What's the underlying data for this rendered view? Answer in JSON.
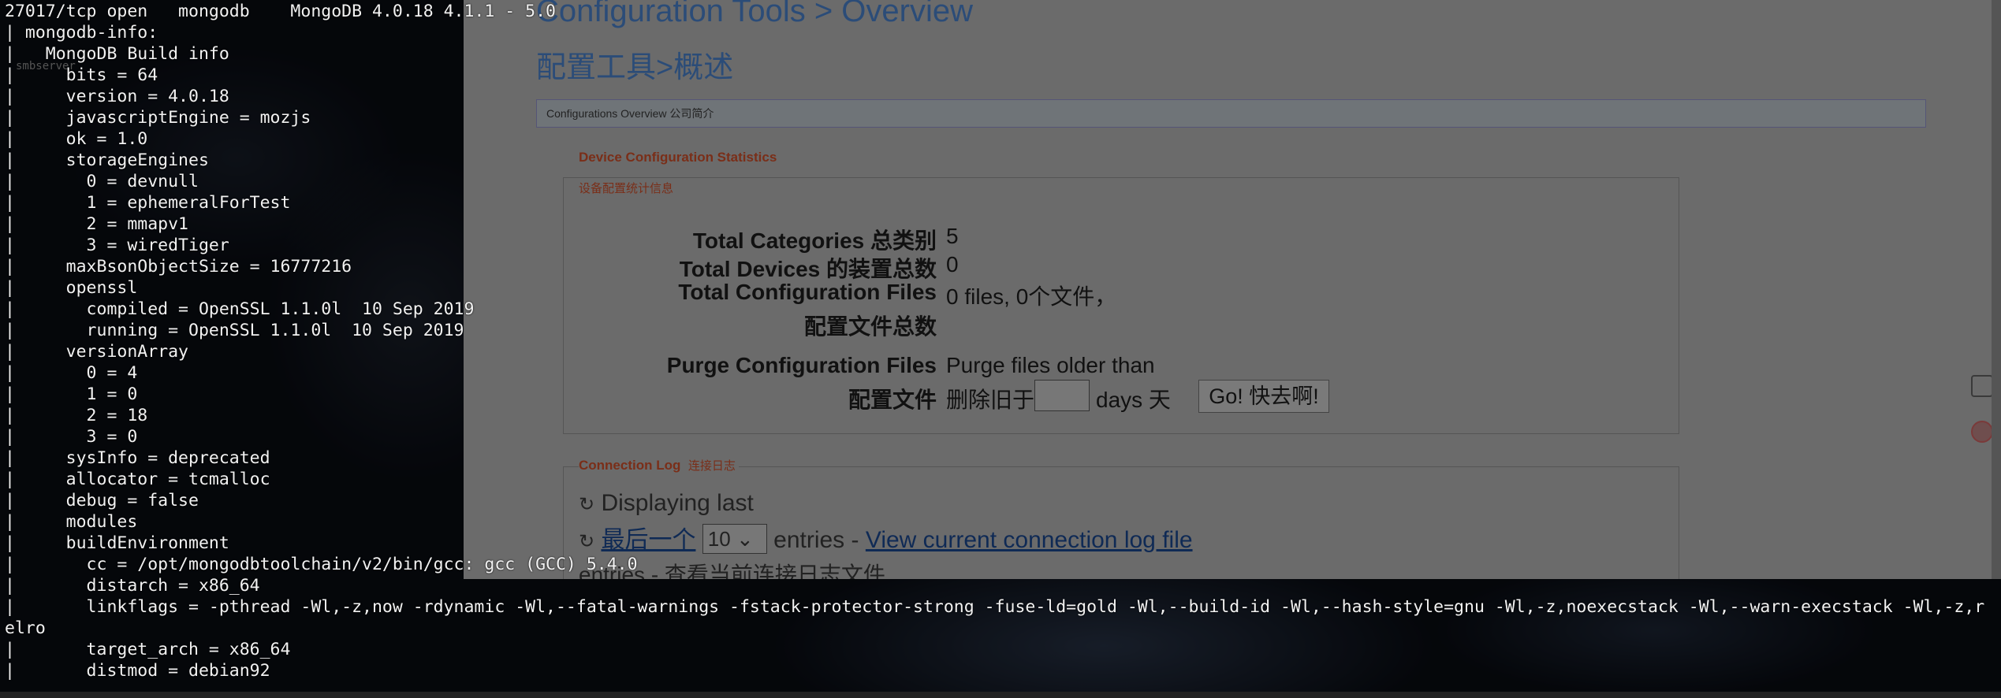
{
  "browser": {
    "title_en": "Configuration Tools > Overview",
    "title_zh": "配置工具>概述",
    "breadcrumb": "Configurations Overview   公司简介",
    "stats_legend_en": "Device Configuration Statistics",
    "stats_legend_zh": "设备配置统计信息",
    "stats": {
      "total_categories_label": "Total Categories  总类别",
      "total_categories_value": "5",
      "total_devices_label": "Total Devices  的装置总数",
      "total_devices_value": "0",
      "total_config_files_label": "Total Configuration Files",
      "total_config_files_label_zh": "配置文件总数",
      "total_config_files_value": "0 files,  0个文件，",
      "purge_label": "Purge Configuration Files",
      "purge_label_zh": "配置文件",
      "purge_text": "Purge files older than",
      "purge_text_zh": "删除旧于",
      "purge_days_value": "",
      "purge_days_label": "days   天",
      "go_button": "Go!  快去啊!"
    },
    "connection_log": {
      "legend_en": "Connection Log",
      "legend_zh": "连接日志",
      "displaying_last": "Displaying last",
      "last_one_zh": "最后一个",
      "entries_select": "10 ⌄",
      "entries_text": "entries -",
      "view_link": "View current connection log file",
      "view_link_zh": "entries - 查看当前连接日志文件"
    },
    "side_icons": [
      "grid-icon",
      "avatar-icon"
    ]
  },
  "terminal": {
    "smbserver_label": "smbserver",
    "lines": [
      "27017/tcp open   mongodb    MongoDB 4.0.18 4.1.1 - 5.0",
      "| mongodb-info:",
      "|   MongoDB Build info",
      "|     bits = 64",
      "|     version = 4.0.18",
      "|     javascriptEngine = mozjs",
      "|     ok = 1.0",
      "|     storageEngines",
      "|       0 = devnull",
      "|       1 = ephemeralForTest",
      "|       2 = mmapv1",
      "|       3 = wiredTiger",
      "|     maxBsonObjectSize = 16777216",
      "|     openssl",
      "|       compiled = OpenSSL 1.1.0l  10 Sep 2019",
      "|       running = OpenSSL 1.1.0l  10 Sep 2019",
      "|     versionArray",
      "|       0 = 4",
      "|       1 = 0",
      "|       2 = 18",
      "|       3 = 0",
      "|     sysInfo = deprecated",
      "|     allocator = tcmalloc",
      "|     debug = false",
      "|     modules",
      "|     buildEnvironment",
      "|       cc = /opt/mongodbtoolchain/v2/bin/gcc: gcc (GCC) 5.4.0",
      "|       distarch = x86_64",
      "|       linkflags = -pthread -Wl,-z,now -rdynamic -Wl,--fatal-warnings -fstack-protector-strong -fuse-ld=gold -Wl,--build-id -Wl,--hash-style=gnu -Wl,-z,noexecstack -Wl,--warn-execstack -Wl,-z,r",
      "elro",
      "|       target_arch = x86_64",
      "|       distmod = debian92"
    ]
  }
}
